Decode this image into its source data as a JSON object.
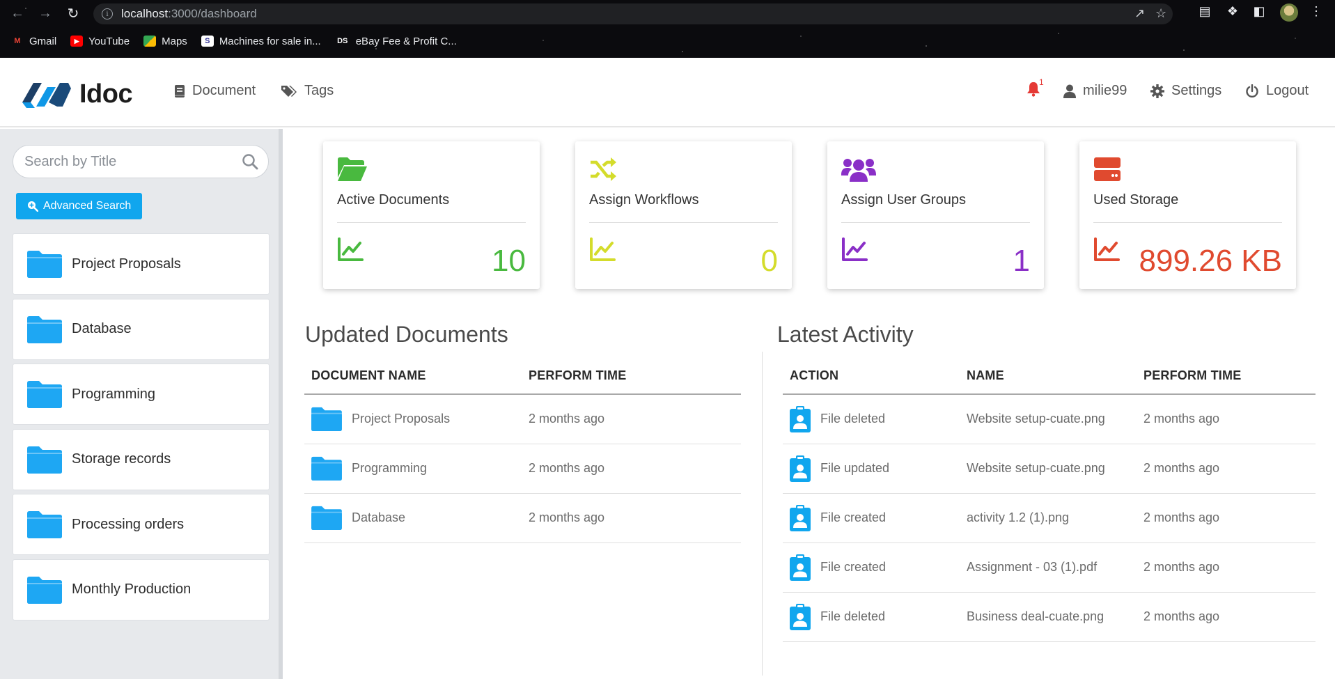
{
  "browser": {
    "url_host": "localhost",
    "url_rest": ":3000/dashboard",
    "bookmarks": [
      {
        "label": "Gmail",
        "icon": "gmail-icon"
      },
      {
        "label": "YouTube",
        "icon": "youtube-icon"
      },
      {
        "label": "Maps",
        "icon": "maps-icon"
      },
      {
        "label": "Machines for sale in...",
        "icon": "site-favicon"
      },
      {
        "label": "eBay Fee & Profit C...",
        "icon": "ds-favicon",
        "icon_text": "DS"
      }
    ]
  },
  "header": {
    "brand": "Idoc",
    "nav": [
      {
        "label": "Document",
        "icon": "book-icon"
      },
      {
        "label": "Tags",
        "icon": "tags-icon"
      }
    ],
    "notification_count": "1",
    "username": "milie99",
    "settings_label": "Settings",
    "logout_label": "Logout"
  },
  "sidebar": {
    "search_placeholder": "Search by Title",
    "advanced_search_label": "Advanced Search",
    "folders": [
      "Project Proposals",
      "Database",
      "Programming",
      "Storage records",
      "Processing orders",
      "Monthly Production"
    ]
  },
  "stats": [
    {
      "title": "Active Documents",
      "value": "10",
      "color": "#49b93f",
      "icon": "folder-open-icon"
    },
    {
      "title": "Assign Workflows",
      "value": "0",
      "color": "#d4dc2b",
      "icon": "shuffle-icon"
    },
    {
      "title": "Assign User Groups",
      "value": "1",
      "color": "#8a2fc7",
      "icon": "users-icon"
    },
    {
      "title": "Used Storage",
      "value": "899.26 KB",
      "color": "#e04a2f",
      "icon": "server-icon"
    }
  ],
  "updated_documents": {
    "title": "Updated Documents",
    "columns": [
      "DOCUMENT NAME",
      "PERFORM TIME"
    ],
    "rows": [
      {
        "name": "Project Proposals",
        "time": "2 months ago"
      },
      {
        "name": "Programming",
        "time": "2 months ago"
      },
      {
        "name": "Database",
        "time": "2 months ago"
      }
    ]
  },
  "latest_activity": {
    "title": "Latest Activity",
    "columns": [
      "ACTION",
      "NAME",
      "PERFORM TIME"
    ],
    "rows": [
      {
        "action": "File deleted",
        "name": "Website setup-cuate.png",
        "time": "2 months ago"
      },
      {
        "action": "File updated",
        "name": "Website setup-cuate.png",
        "time": "2 months ago"
      },
      {
        "action": "File created",
        "name": "activity 1.2 (1).png",
        "time": "2 months ago"
      },
      {
        "action": "File created",
        "name": "Assignment - 03 (1).pdf",
        "time": "2 months ago"
      },
      {
        "action": "File deleted",
        "name": "Business deal-cuate.png",
        "time": "2 months ago"
      }
    ]
  },
  "colors": {
    "accent": "#10a6ee",
    "folder": "#1ea7f3",
    "clipboard": "#10a6ee",
    "bell": "#e53935"
  }
}
